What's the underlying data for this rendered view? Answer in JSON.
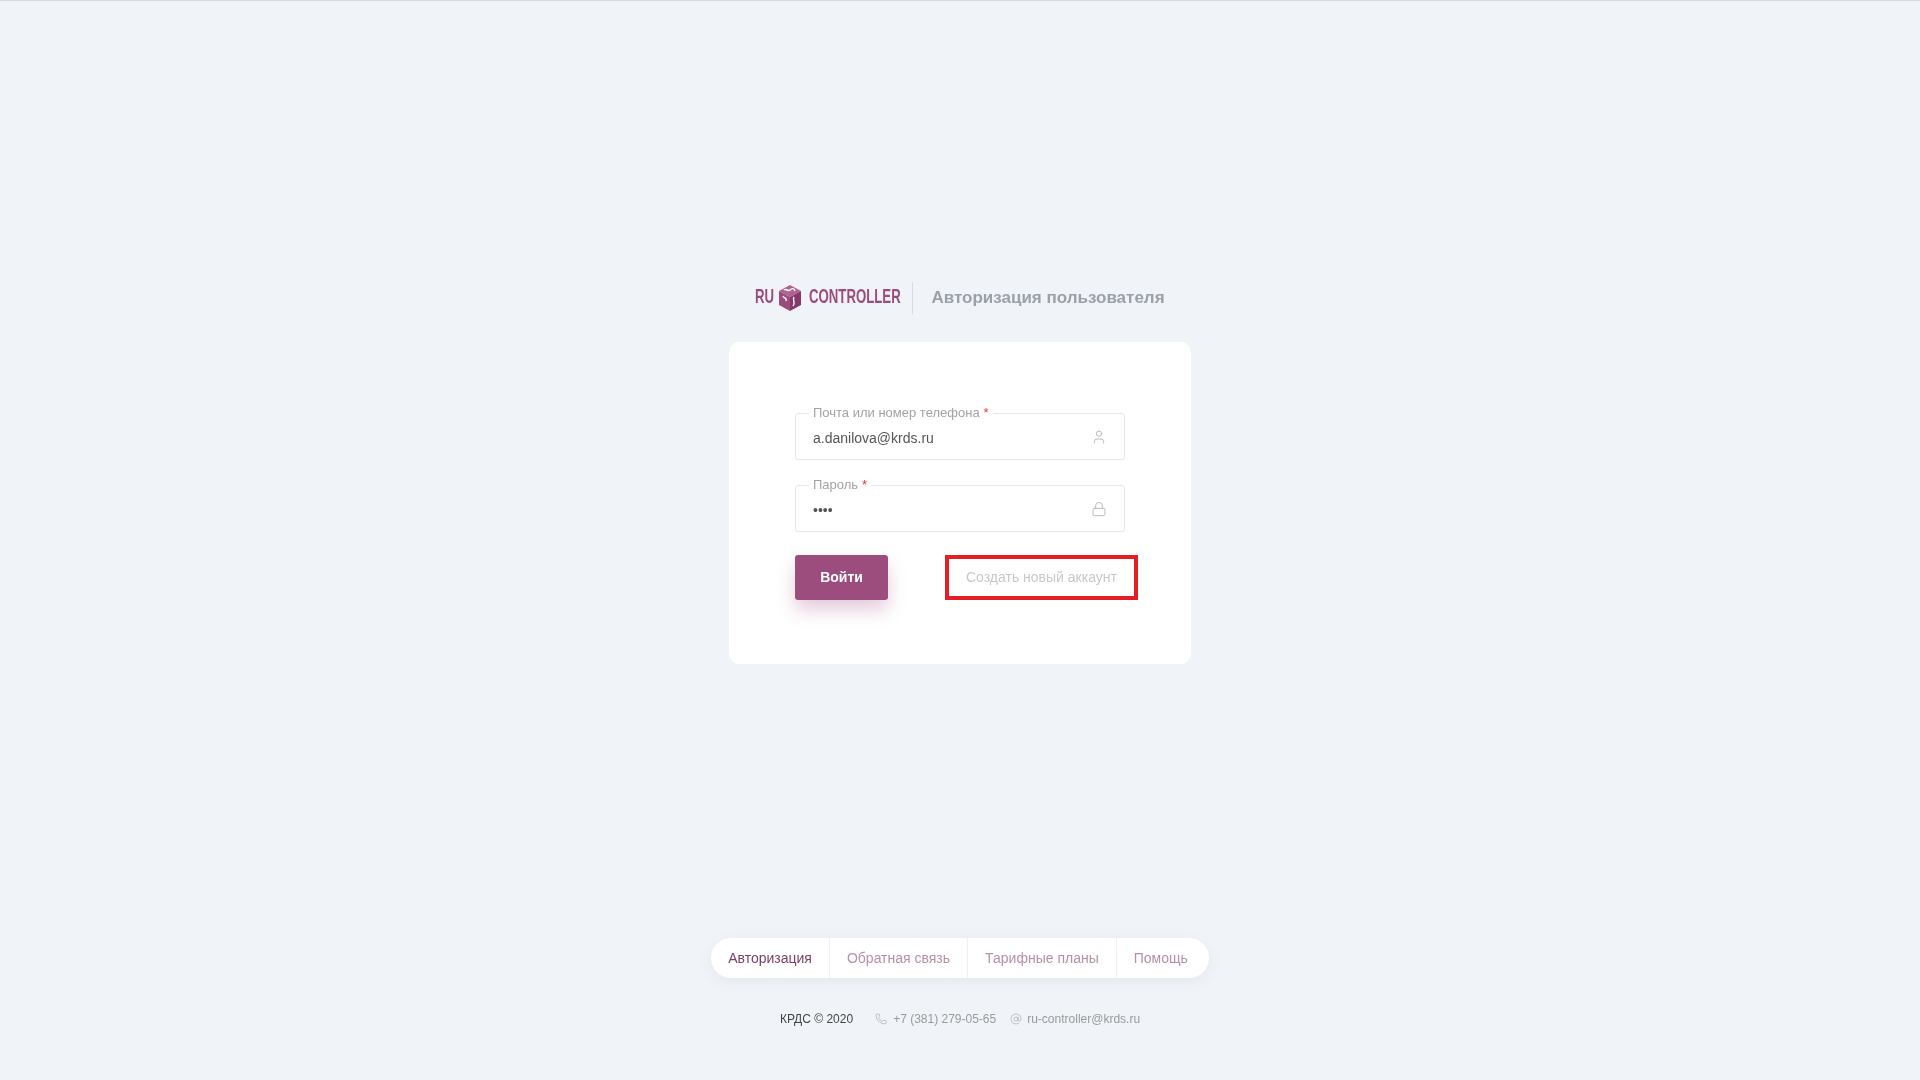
{
  "header": {
    "logo": {
      "text_left": "RU",
      "text_right": "CONTROLLER"
    },
    "title": "Авторизация пользователя"
  },
  "login_form": {
    "fields": [
      {
        "kind": "user",
        "label": "Почта или номер телефона",
        "required_mark": "*",
        "value": "a.danilova@krds.ru"
      },
      {
        "kind": "password",
        "label": "Пароль",
        "required_mark": "*",
        "value": "••••"
      }
    ],
    "submit_button": "Войти",
    "register_link": {
      "label": "Создать новый аккаунт",
      "highlighted": true
    }
  },
  "footer_nav": [
    {
      "label": "Авторизация",
      "selected": true
    },
    {
      "label": "Обратная связь",
      "selected": false
    },
    {
      "label": "Тарифные планы",
      "selected": false
    },
    {
      "label": "Помощь",
      "selected": false
    }
  ],
  "footer_contacts": {
    "copyright": "КРДС © 2020",
    "phone": "+7 (381) 279-05-65",
    "email": "ru-controller@krds.ru"
  }
}
